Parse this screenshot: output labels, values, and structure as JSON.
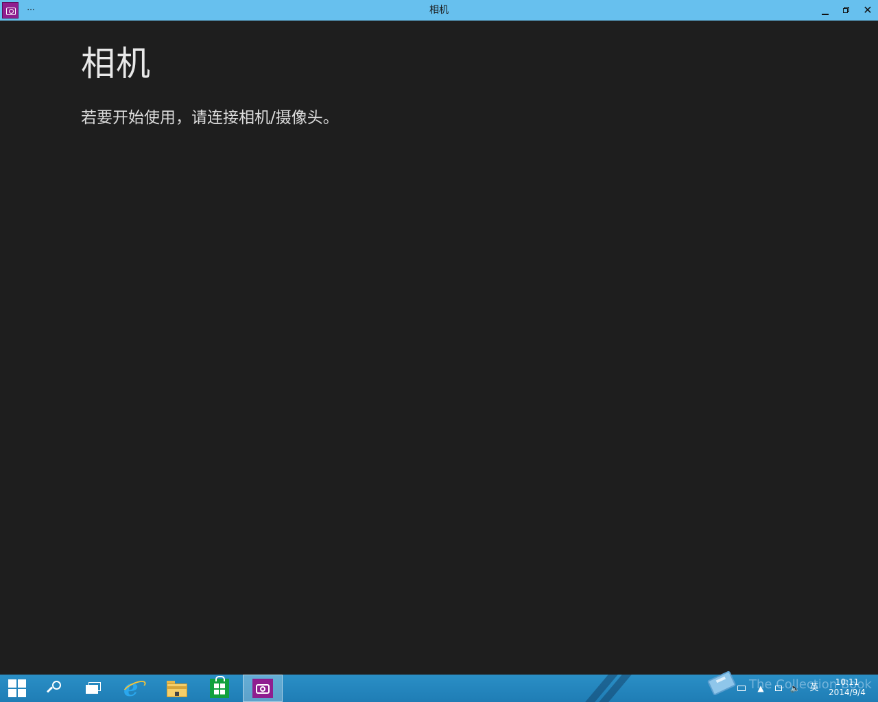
{
  "window": {
    "title": "相机",
    "menu_label": "···",
    "controls": {
      "minimize_icon": "minimize-icon",
      "maximize_icon": "restore-icon",
      "close_symbol": "✕"
    }
  },
  "main": {
    "heading": "相机",
    "message": "若要开始使用，请连接相机/摄像头。"
  },
  "taskbar": {
    "pinned": [
      {
        "name": "start",
        "icon": "windows-logo-icon"
      },
      {
        "name": "search",
        "icon": "search-icon"
      },
      {
        "name": "task-view",
        "icon": "task-view-icon"
      },
      {
        "name": "internet-explorer",
        "icon": "internet-explorer-icon"
      },
      {
        "name": "file-explorer",
        "icon": "folder-icon"
      },
      {
        "name": "store",
        "icon": "store-icon"
      },
      {
        "name": "camera",
        "icon": "camera-icon",
        "active": true
      }
    ],
    "watermark": "The Collection Book",
    "tray": {
      "chevron": "▲",
      "volume": "🔈",
      "language": "英",
      "time": "10:11",
      "date": "2014/9/4"
    }
  },
  "colors": {
    "titlebar": "#67c0ee",
    "background": "#1e1e1e",
    "taskbar": "#2a8fc6",
    "camera_accent": "#8f1e8f"
  }
}
